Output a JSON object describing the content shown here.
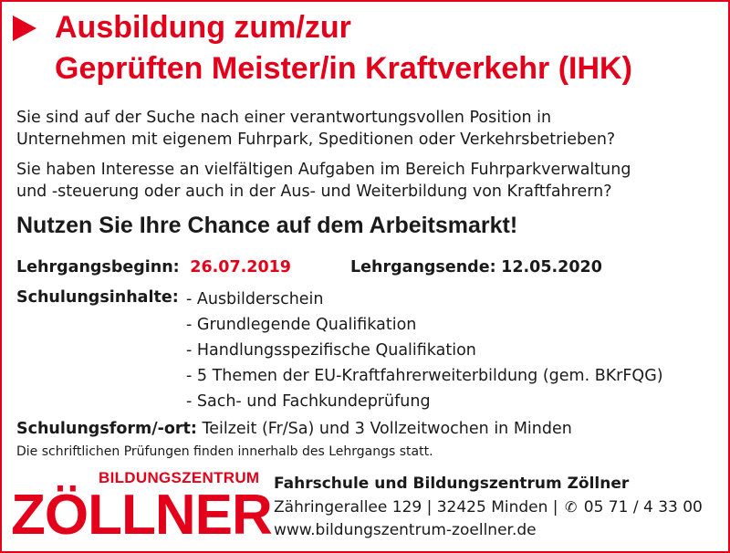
{
  "headline": {
    "line1": "Ausbildung zum/zur",
    "line2": "Geprüften Meister/in Kraftverkehr (IHK)"
  },
  "intro": {
    "para1_line1": "Sie sind auf der Suche nach einer verantwortungsvollen Position in",
    "para1_line2": "Unternehmen mit eigenem Fuhrpark, Speditionen oder Verkehrsbetrieben?",
    "para2_line1": "Sie haben Interesse an vielfältigen Aufgaben im Bereich Fuhrparkverwaltung",
    "para2_line2": "und -steuerung oder auch in der Aus- und Weiterbildung von Kraftfahrern?"
  },
  "chance": "Nutzen Sie Ihre Chance auf dem Arbeitsmarkt!",
  "dates": {
    "begin_label": "Lehrgangsbeginn:",
    "begin_value": "26.07.2019",
    "end_label": "Lehrgangsende:",
    "end_value": "12.05.2020"
  },
  "contents": {
    "label": "Schulungsinhalte:",
    "items": [
      "- Ausbilderschein",
      "- Grundlegende Qualifikation",
      "- Handlungsspezifische Qualifikation",
      "- 5 Themen der EU-Kraftfahrerweiterbildung (gem. BKrFQG)",
      "- Sach- und Fachkundeprüfung"
    ]
  },
  "form": {
    "label": "Schulungsform/-ort:",
    "value": "Teilzeit (Fr/Sa) und 3 Vollzeitwochen in Minden"
  },
  "note": "Die schriftlichen Prüfungen finden innerhalb des Lehrgangs statt.",
  "logo": {
    "subtitle": "BILDUNGSZENTRUM",
    "name": "ZÖLLNER"
  },
  "contact": {
    "name": "Fahrschule und Bildungszentrum Zöllner",
    "address": "Zähringerallee 129 | 32425 Minden |",
    "phone_icon": "phone-icon",
    "phone": "05 71 / 4 33 00",
    "website": "www.bildungszentrum-zoellner.de"
  },
  "colors": {
    "accent": "#e2001a",
    "text": "#1a1a1a"
  }
}
